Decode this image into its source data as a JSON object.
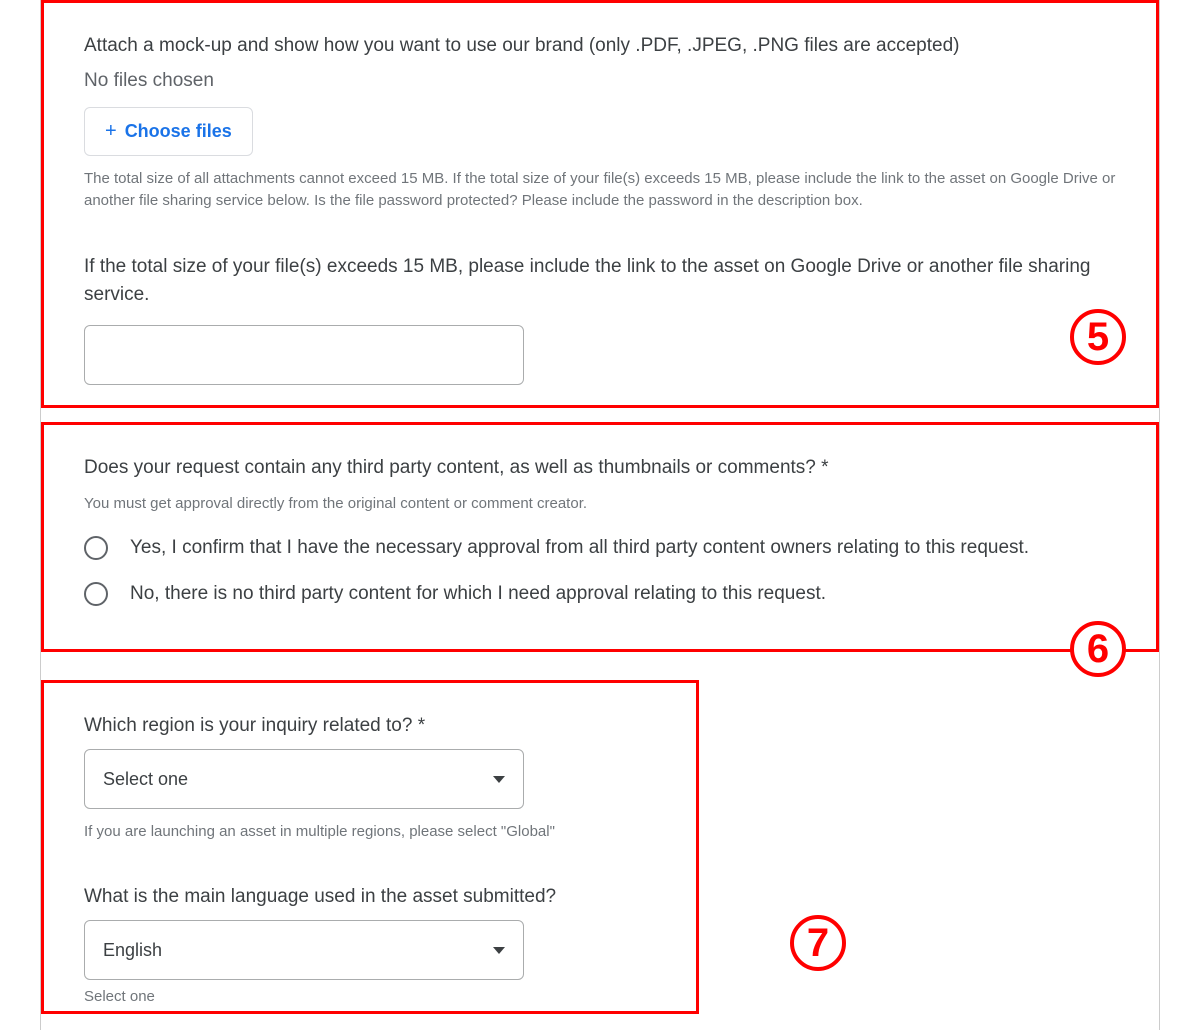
{
  "section5": {
    "question": "Attach a mock-up and show how you want to use our brand (only .PDF, .JPEG, .PNG files are accepted)",
    "no_files": "No files chosen",
    "choose_files_label": "Choose files",
    "helper": "The total size of all attachments cannot exceed 15 MB. If the total size of your file(s) exceeds 15 MB, please include the link to the asset on Google Drive or another file sharing service below. Is the file password protected? Please include the password in the description box.",
    "followup_question": "If the total size of your file(s) exceeds 15 MB, please include the link to the asset on Google Drive or another file sharing service.",
    "badge": "5"
  },
  "section6": {
    "question": "Does your request contain any third party content, as well as thumbnails or comments? *",
    "helper": "You must get approval directly from the original content or comment creator.",
    "option_yes": "Yes, I confirm that I have the necessary approval from all third party content owners relating to this request.",
    "option_no": "No, there is no third party content for which I need approval relating to this request.",
    "badge": "6"
  },
  "section7": {
    "region_question": "Which region is your inquiry related to? *",
    "region_select_value": "Select one",
    "region_helper": "If you are launching an asset in multiple regions, please select \"Global\"",
    "language_question": "What is the main language used in the asset submitted?",
    "language_select_value": "English",
    "language_helper": "Select one",
    "badge": "7"
  }
}
